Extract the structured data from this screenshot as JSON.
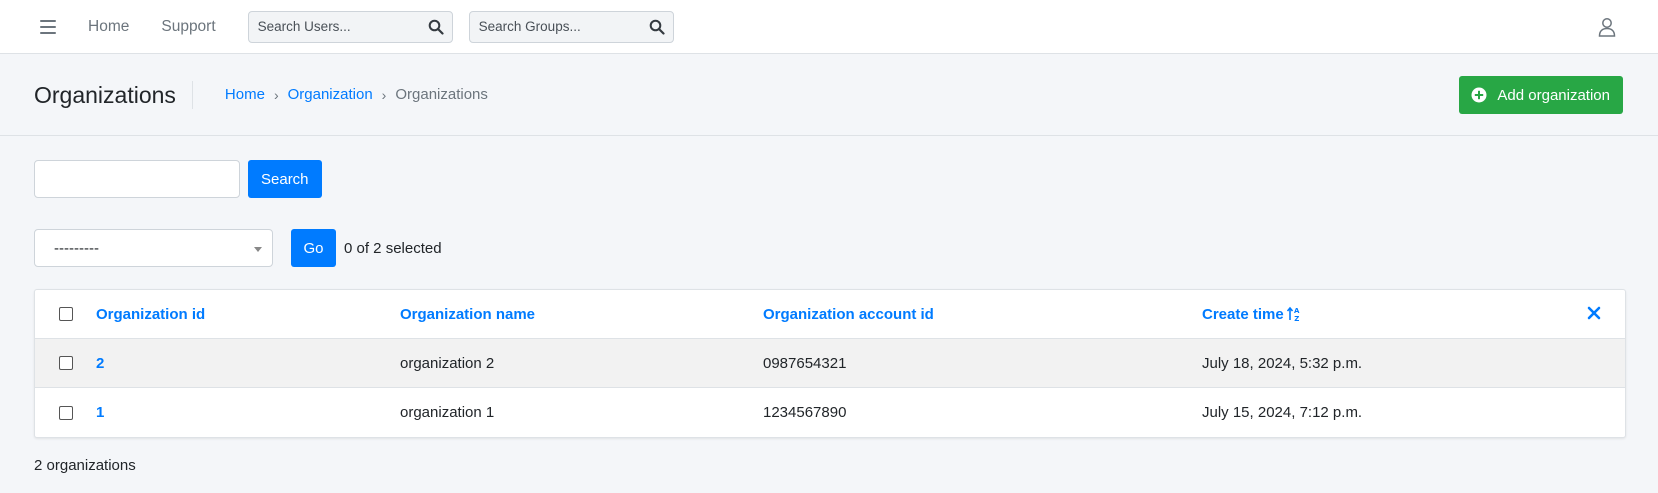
{
  "topbar": {
    "nav_home": "Home",
    "nav_support": "Support",
    "search_users_placeholder": "Search Users...",
    "search_groups_placeholder": "Search Groups..."
  },
  "header": {
    "title": "Organizations",
    "breadcrumb": {
      "home": "Home",
      "organization": "Organization",
      "current": "Organizations",
      "separator": "›"
    },
    "add_button_label": "Add organization"
  },
  "search": {
    "value": "",
    "button_label": "Search"
  },
  "actions": {
    "selected_value": "---------",
    "go_label": "Go",
    "selected_count": "0 of 2 selected"
  },
  "table": {
    "columns": [
      "Organization id",
      "Organization name",
      "Organization account id",
      "Create time"
    ],
    "rows": [
      {
        "id": "2",
        "name": "organization 2",
        "account_id": "0987654321",
        "create_time": "July 18, 2024, 5:32 p.m."
      },
      {
        "id": "1",
        "name": "organization 1",
        "account_id": "1234567890",
        "create_time": "July 15, 2024, 7:12 p.m."
      }
    ]
  },
  "footer": {
    "count_text": "2 organizations"
  },
  "colors": {
    "primary": "#007bff",
    "success": "#28a745",
    "background": "#f4f6f9"
  },
  "icons": {
    "menu": "hamburger-icon",
    "search": "search-icon",
    "user": "user-icon",
    "add": "plus-circle-icon",
    "sort": "sort-ascending-icon",
    "clear": "close-icon"
  }
}
